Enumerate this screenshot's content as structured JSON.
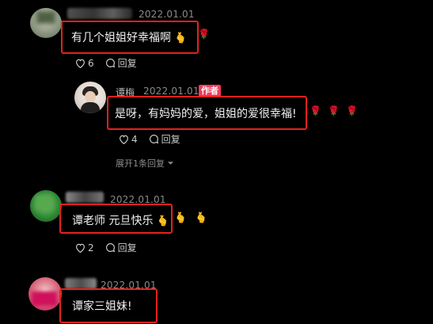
{
  "comments": [
    {
      "date": "2022.01.01",
      "text": "有几个姐姐好幸福啊",
      "emoji": "🫰",
      "likes": "6",
      "reply_label": "回复"
    },
    {
      "username": "谭梅",
      "date": "2022.01.01",
      "badge": "作者",
      "text": "是呀，有妈妈的爱，姐姐的爱很幸福!",
      "likes": "4",
      "reply_label": "回复",
      "roses": [
        "🌹",
        "🌹",
        "🌹"
      ]
    },
    {
      "expand_label": "展开1条回复"
    },
    {
      "date": "2022.01.01",
      "text": "谭老师 元旦快乐",
      "emoji": "🫰",
      "extra_emojis": [
        "🫰",
        "🫰"
      ],
      "likes": "2",
      "reply_label": "回复"
    },
    {
      "date": "2022.01.01",
      "text": "谭家三姐妹!"
    }
  ],
  "colors": {
    "highlight": "#e8211c",
    "author_badge": "#f03d5c",
    "background": "#000000"
  },
  "icons": [
    "heart-icon",
    "reply-bubble-icon",
    "chevron-down-icon",
    "rose-icon",
    "finger-heart-emoji"
  ]
}
